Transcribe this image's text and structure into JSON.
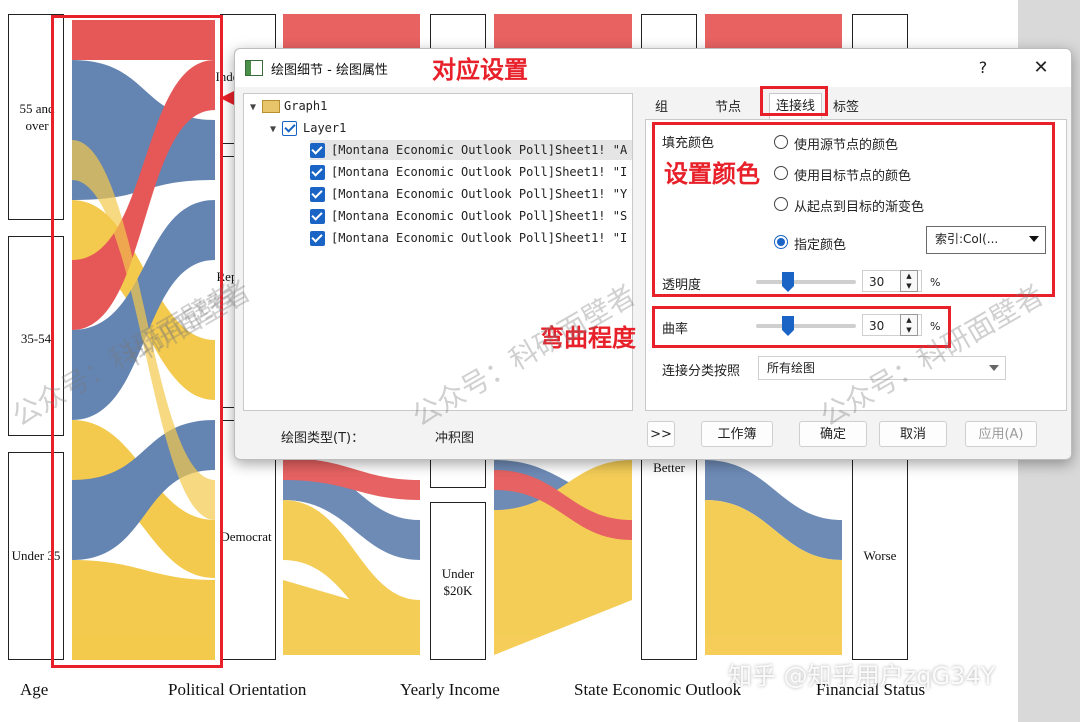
{
  "chart": {
    "axes": [
      {
        "id": "age",
        "label": "Age"
      },
      {
        "id": "political",
        "label": "Political Orientation"
      },
      {
        "id": "income",
        "label": "Yearly Income"
      },
      {
        "id": "state",
        "label": "State Economic Outlook"
      },
      {
        "id": "financial",
        "label": "Financial Status"
      }
    ],
    "age_nodes": [
      "55 and over",
      "35-54",
      "Under 35"
    ],
    "political_nodes": [
      "Inde",
      "Rep",
      "Democrat"
    ],
    "income_nodes": [
      "Under $20K"
    ],
    "state_nodes": [
      "Better"
    ],
    "financial_nodes": [
      "Worse"
    ],
    "colors": {
      "red": "#e23b3b",
      "blue": "#4a6fa5",
      "yellow": "#f2c12e",
      "annotation": "#e8202a"
    }
  },
  "annotations": {
    "corresponding_settings": "对应设置",
    "set_color": "设置颜色",
    "curvature_level": "弯曲程度"
  },
  "watermarks": [
    "公众号：科研面壁者",
    "公众号：科研面壁者",
    "公众号：科研面壁者",
    "公众号：科研面壁者",
    "科研面壁者"
  ],
  "zhihu_watermark": "知乎 @知乎用户zqG34Y",
  "dialog": {
    "title": "绘图细节 - 绘图属性",
    "help": "?",
    "close": "✕",
    "tree": {
      "graph": "Graph1",
      "layer": "Layer1",
      "items": [
        "[Montana Economic Outlook Poll]Sheet1! \"A",
        "[Montana Economic Outlook Poll]Sheet1! \"I",
        "[Montana Economic Outlook Poll]Sheet1! \"Y",
        "[Montana Economic Outlook Poll]Sheet1! \"S",
        "[Montana Economic Outlook Poll]Sheet1! \"I"
      ]
    },
    "plot_type_label": "绘图类型(T)：",
    "plot_type_value": "冲积图",
    "tabs": [
      "组",
      "节点",
      "连接线",
      "标签"
    ],
    "active_tab": "连接线",
    "fill_color_label": "填充颜色",
    "options": [
      "使用源节点的颜色",
      "使用目标节点的颜色",
      "从起点到目标的渐变色",
      "指定颜色"
    ],
    "selected_option": "指定颜色",
    "color_combo": "索引:Col(...",
    "transparency_label": "透明度",
    "transparency_value": "30",
    "transparency_unit": "%",
    "curvature_label": "曲率",
    "curvature_value": "30",
    "curvature_unit": "%",
    "classify_label": "连接分类按照",
    "classify_value": "所有绘图",
    "buttons": {
      "expand": ">>",
      "workbook": "工作簿",
      "ok": "确定",
      "cancel": "取消",
      "apply": "应用(A)"
    }
  }
}
